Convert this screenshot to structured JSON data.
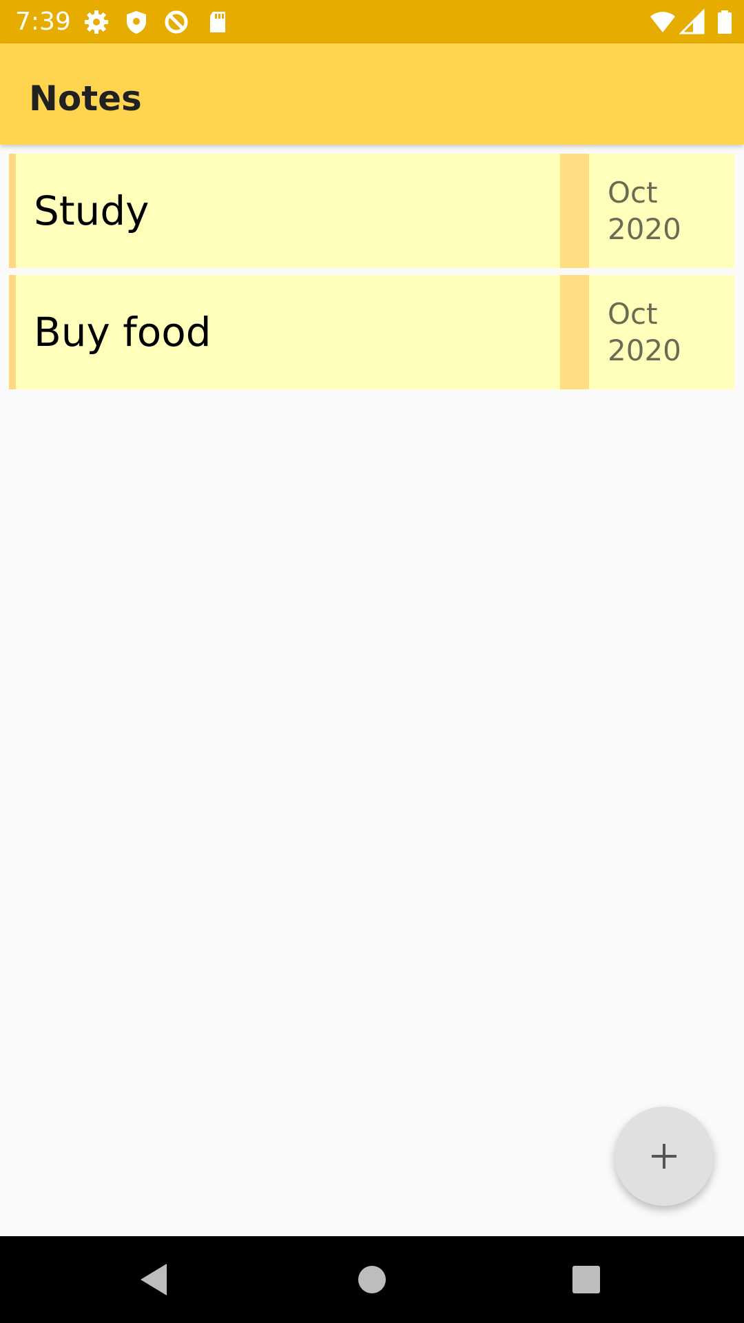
{
  "status_bar": {
    "time": "7:39",
    "icons": [
      "gear-icon",
      "shield-icon",
      "sync-off-icon",
      "sd-card-icon",
      "wifi-icon",
      "signal-icon",
      "battery-icon"
    ]
  },
  "app_bar": {
    "title": "Notes"
  },
  "notes": [
    {
      "title": "Study",
      "date_month": "Oct",
      "date_year": "2020"
    },
    {
      "title": "Buy food",
      "date_month": "Oct",
      "date_year": "2020"
    }
  ],
  "fab": {
    "icon": "plus-icon"
  },
  "nav_bar": {
    "icons": [
      "back-icon",
      "home-icon",
      "recents-icon"
    ]
  },
  "colors": {
    "status_bar": "#E6AC00",
    "app_bar": "#FFD54F",
    "note_background": "#FFFFBB",
    "note_accent": "#FFDD80"
  }
}
